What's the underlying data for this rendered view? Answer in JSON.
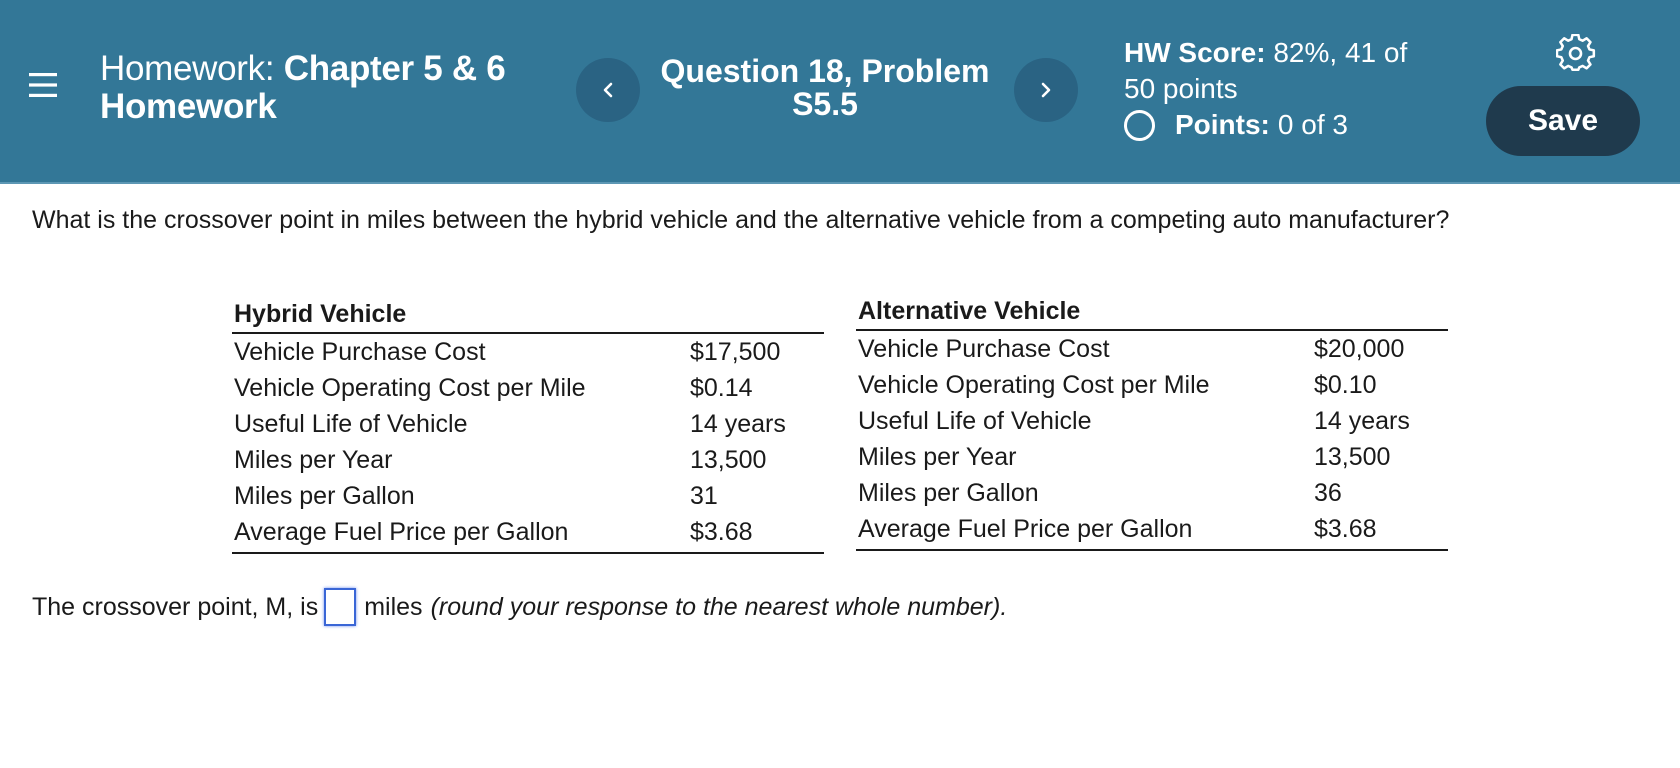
{
  "header": {
    "title_prefix": "Homework:",
    "title_line1_bold": "Chapter 5 & 6",
    "title_line2_bold": "Homework",
    "question_line1": "Question 18, Problem",
    "question_line2": "S5.5",
    "hw_score_label": "HW Score:",
    "hw_score_line1": "82%, 41 of",
    "hw_score_line2": "50 points",
    "points_label": "Points:",
    "points_value": "0 of 3",
    "save_label": "Save",
    "prev_glyph": "‹",
    "next_glyph": "›"
  },
  "question": {
    "text": "What is the crossover point in miles between the hybrid vehicle and the alternative vehicle from a competing auto manufacturer?"
  },
  "tables": {
    "hybrid": {
      "title": "Hybrid Vehicle",
      "rows": [
        {
          "label": "Vehicle Purchase Cost",
          "value": "$17,500"
        },
        {
          "label": "Vehicle Operating Cost per Mile",
          "value": "$0.14"
        },
        {
          "label": "Useful Life of Vehicle",
          "value": "14 years"
        },
        {
          "label": "Miles per Year",
          "value": "13,500"
        },
        {
          "label": "Miles per Gallon",
          "value": "31"
        },
        {
          "label": "Average Fuel Price per Gallon",
          "value": "$3.68"
        }
      ]
    },
    "alternative": {
      "title": "Alternative Vehicle",
      "rows": [
        {
          "label": "Vehicle Purchase Cost",
          "value": "$20,000"
        },
        {
          "label": "Vehicle Operating Cost per Mile",
          "value": "$0.10"
        },
        {
          "label": "Useful Life of Vehicle",
          "value": "14 years"
        },
        {
          "label": "Miles per Year",
          "value": "13,500"
        },
        {
          "label": "Miles per Gallon",
          "value": "36"
        },
        {
          "label": "Average Fuel Price per Gallon",
          "value": "$3.68"
        }
      ]
    }
  },
  "answer": {
    "prefix": "The crossover point, M, is",
    "input_value": "",
    "suffix": "miles",
    "hint": "(round your response to the nearest whole number)."
  },
  "icons": {
    "menu": "hamburger-menu-icon",
    "prev": "chevron-left-icon",
    "next": "chevron-right-icon",
    "settings": "gear-icon",
    "points_status": "empty-circle-icon"
  },
  "colors": {
    "header_bg": "#337797",
    "nav_button_bg": "#2a6383",
    "save_button_bg": "#1f3a4d",
    "input_border": "#3a66d6"
  }
}
